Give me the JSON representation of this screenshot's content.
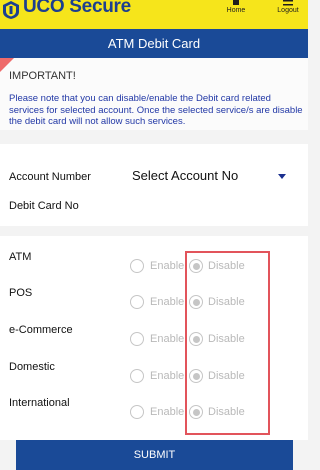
{
  "app": {
    "name": "UCO Secure",
    "accent_color": "#f6e51b",
    "brand_blue": "#1a4a97"
  },
  "top_actions": {
    "home_label": "Home",
    "home_icon": "home-icon",
    "logout_label": "Logout",
    "logout_icon": "logout-icon"
  },
  "header": {
    "title": "ATM Debit Card"
  },
  "notice": {
    "title": "IMPORTANT!",
    "text": "Please note that you can disable/enable the  Debit card related services for selected account. Once the selected service/s are disable the debit card will not allow such services."
  },
  "account": {
    "account_number_label": "Account Number",
    "select_value": "Select Account No",
    "debit_card_label": "Debit Card No"
  },
  "services": [
    {
      "label": "ATM",
      "enable_label": "Enable",
      "disable_label": "Disable",
      "selected": "Disable"
    },
    {
      "label": "POS",
      "enable_label": "Enable",
      "disable_label": "Disable",
      "selected": "Disable"
    },
    {
      "label": "e-Commerce",
      "enable_label": "Enable",
      "disable_label": "Disable",
      "selected": "Disable"
    },
    {
      "label": "Domestic",
      "enable_label": "Enable",
      "disable_label": "Disable",
      "selected": "Disable"
    },
    {
      "label": "International",
      "enable_label": "Enable",
      "disable_label": "Disable",
      "selected": "Disable"
    }
  ],
  "submit_label": "SUBMIT"
}
